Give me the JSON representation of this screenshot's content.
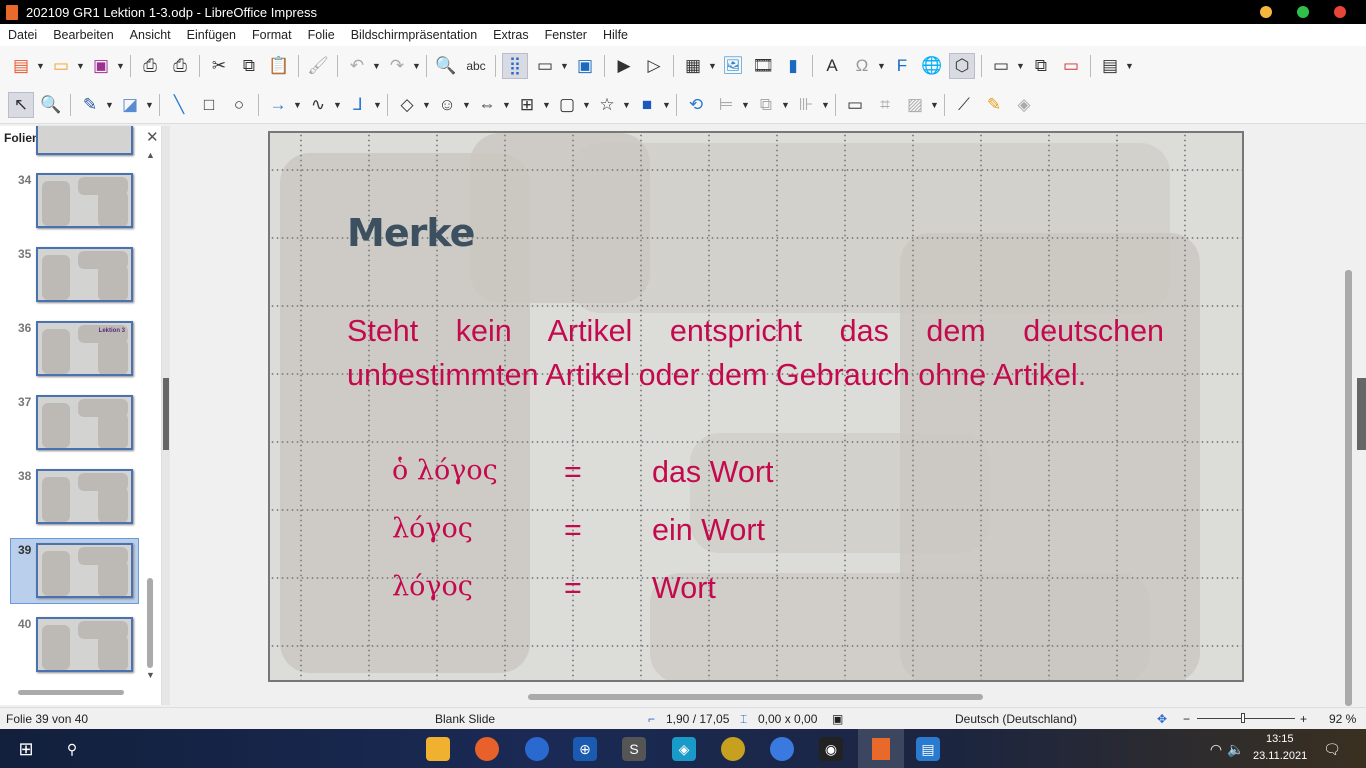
{
  "window": {
    "title": "202109 GR1 Lektion 1-3.odp - LibreOffice Impress"
  },
  "menu": [
    "Datei",
    "Bearbeiten",
    "Ansicht",
    "Einfügen",
    "Format",
    "Folie",
    "Bildschirmpräsentation",
    "Extras",
    "Fenster",
    "Hilfe"
  ],
  "toolbar1": [
    "new-icon",
    "open-icon",
    "save-icon",
    "export-pdf-icon",
    "print-icon",
    "cut-icon",
    "copy-icon",
    "paste-icon",
    "clone-formatting-icon",
    "undo-icon",
    "redo-icon",
    "find-replace-icon",
    "spelling-icon",
    "grid-icon",
    "display-views-icon",
    "master-slide-icon",
    "start-first-icon",
    "start-current-icon",
    "table-icon",
    "image-icon",
    "media-icon",
    "chart-icon",
    "textbox-icon",
    "special-char-icon",
    "fontwork-icon",
    "hyperlink-icon",
    "shapes-icon",
    "new-slide-icon",
    "duplicate-slide-icon",
    "delete-slide-icon",
    "slide-layout-icon"
  ],
  "toolbar2": [
    "select-icon",
    "zoom-icon",
    "line-color-icon",
    "fill-color-icon",
    "line-icon",
    "rectangle-icon",
    "ellipse-icon",
    "arrow-icon",
    "curve-icon",
    "connector-icon",
    "diamond-icon",
    "smiley-icon",
    "double-arrow-icon",
    "flowchart-icon",
    "callout-icon",
    "star-icon",
    "3d-icon",
    "transform-icon",
    "align-icon",
    "arrange-icon",
    "distribute-icon",
    "shadow-icon",
    "crop-icon",
    "filter-icon",
    "points-icon",
    "glue-icon",
    "3d-toggle-icon"
  ],
  "slides_panel": {
    "title": "Folien",
    "slides": [
      {
        "number": "34"
      },
      {
        "number": "35"
      },
      {
        "number": "36",
        "thumb_text": "Lektion 3"
      },
      {
        "number": "37"
      },
      {
        "number": "38"
      },
      {
        "number": "39",
        "selected": true
      },
      {
        "number": "40"
      }
    ]
  },
  "slide": {
    "title": "Merke",
    "body": "Steht kein Artikel entspricht das dem deutschen unbestimmten Artikel oder dem Gebrauch ohne Artikel.",
    "rows": [
      {
        "greek": "ὁ λόγος",
        "eq": "=",
        "german": "das Wort"
      },
      {
        "greek": "λόγος",
        "eq": "=",
        "german": "ein Wort"
      },
      {
        "greek": "λόγος",
        "eq": "=",
        "german": "Wort"
      }
    ],
    "text_color": "#c40a4e",
    "title_color": "#3c5060"
  },
  "status": {
    "slide": "Folie 39 von 40",
    "layout": "Blank Slide",
    "position": "1,90 / 17,05",
    "size": "0,00 x 0,00",
    "language": "Deutsch (Deutschland)",
    "zoom": "92 %",
    "zoom_level": 0.5
  },
  "taskbar": {
    "time": "13:15",
    "date": "23.11.2021",
    "apps": [
      "file-explorer-icon",
      "firefox-icon",
      "thunderbird-icon",
      "magnifier-icon",
      "bs-app-icon",
      "app-icon",
      "photos-icon",
      "signal-icon",
      "messenger-icon",
      "impress-icon",
      "writer-icon"
    ]
  }
}
